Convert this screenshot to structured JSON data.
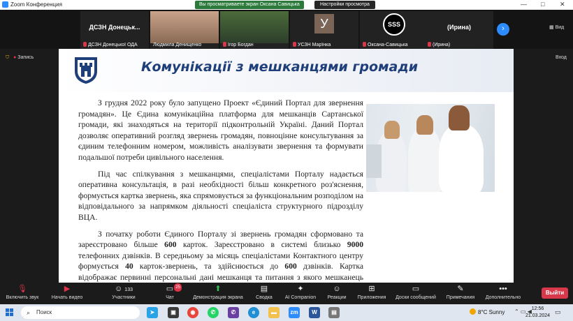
{
  "window": {
    "title": "Zoom Конференция",
    "share_banner": "Вы просматриваете экран Оксана Савицька",
    "view_settings": "Настройки просмотра",
    "controls": [
      "—",
      "□",
      "✕"
    ]
  },
  "participants": [
    {
      "name": "ДСЗН Донецької ОДА",
      "tile_title": "ДСЗН Донецьк...",
      "kind": "title"
    },
    {
      "name": "Людмила Денищенко",
      "kind": "camera"
    },
    {
      "name": "Ігор Богдан",
      "kind": "camera"
    },
    {
      "name": "УСЗН Марїнка",
      "kind": "letter",
      "letter": "У"
    },
    {
      "name": "Оксана-Савицька",
      "kind": "logo",
      "logo_text": "SSS"
    },
    {
      "name": "(Ирина)",
      "tile_title": "(Ирина)",
      "kind": "title"
    }
  ],
  "strip": {
    "view_label": "Вид",
    "next_icon": "chevron-right-icon"
  },
  "recording": {
    "label": "Запись"
  },
  "top_exit": "Вход",
  "slide": {
    "title": "Комунікації з мешканцями громади",
    "paragraphs": [
      "З грудня 2022 року було запущено Проект «Єдиний Портал для звернення громадян». Це Єдина комунікаційна платформа для мешканців Сартанської громади, які знаходяться на території підконтрольній Україні. Даний Портал дозволяє оперативний розгляд звернень громадян, повноцінне консультування за єдиним телефонним номером, можливість аналізувати звернення та формувати подальшої потреби цивільного населення.",
      "Під час спілкування з мешканцями, спеціалістами Порталу надається оперативна консультація, в разі необхідності більш конкретного роз'яснення, формується картка звернень, яка спрямовується за функціональним розподілом на відповідального за напрямком діяльності спеціаліста структурного підрозділу ВЦА."
    ],
    "p3": {
      "a": "З початку роботи Єдиного Порталу зі звернень громадян сформовано та зареєстровано більше ",
      "n1": "600",
      "b": " карток. Зареєстровано в системі близько ",
      "n2": "9000",
      "c": " телефонних дзвінків. В середньому за місяць спеціалістами Контактного центру формується  ",
      "n3": "40",
      "d": " карток-звернень, та здійснюється до ",
      "n4": "600",
      "e": " дзвінків. Картка відображає первинні персональні дані мешканця та питання з якого мешканець звертається. Кожне питання ставиться на окремий облік."
    }
  },
  "toolbar": {
    "mute": "Включить звук",
    "video": "Начать видео",
    "participants": "Участники",
    "participants_count": "133",
    "chat": "Чат",
    "chat_badge": "25",
    "share": "Демонстрация экрана",
    "summary": "Сводка",
    "ai": "AI Companion",
    "reactions": "Реакции",
    "apps": "Приложения",
    "whiteboards": "Доски сообщений",
    "notes": "Примечания",
    "more": "Дополнительно",
    "leave": "Выйти"
  },
  "taskbar": {
    "search": "Поиск",
    "weather": "8°C  Sunny",
    "time": "12:56",
    "date": "21.03.2024"
  },
  "colors": {
    "accent": "#2d8cff",
    "leave": "#d9374a",
    "title": "#1f3f7a"
  }
}
